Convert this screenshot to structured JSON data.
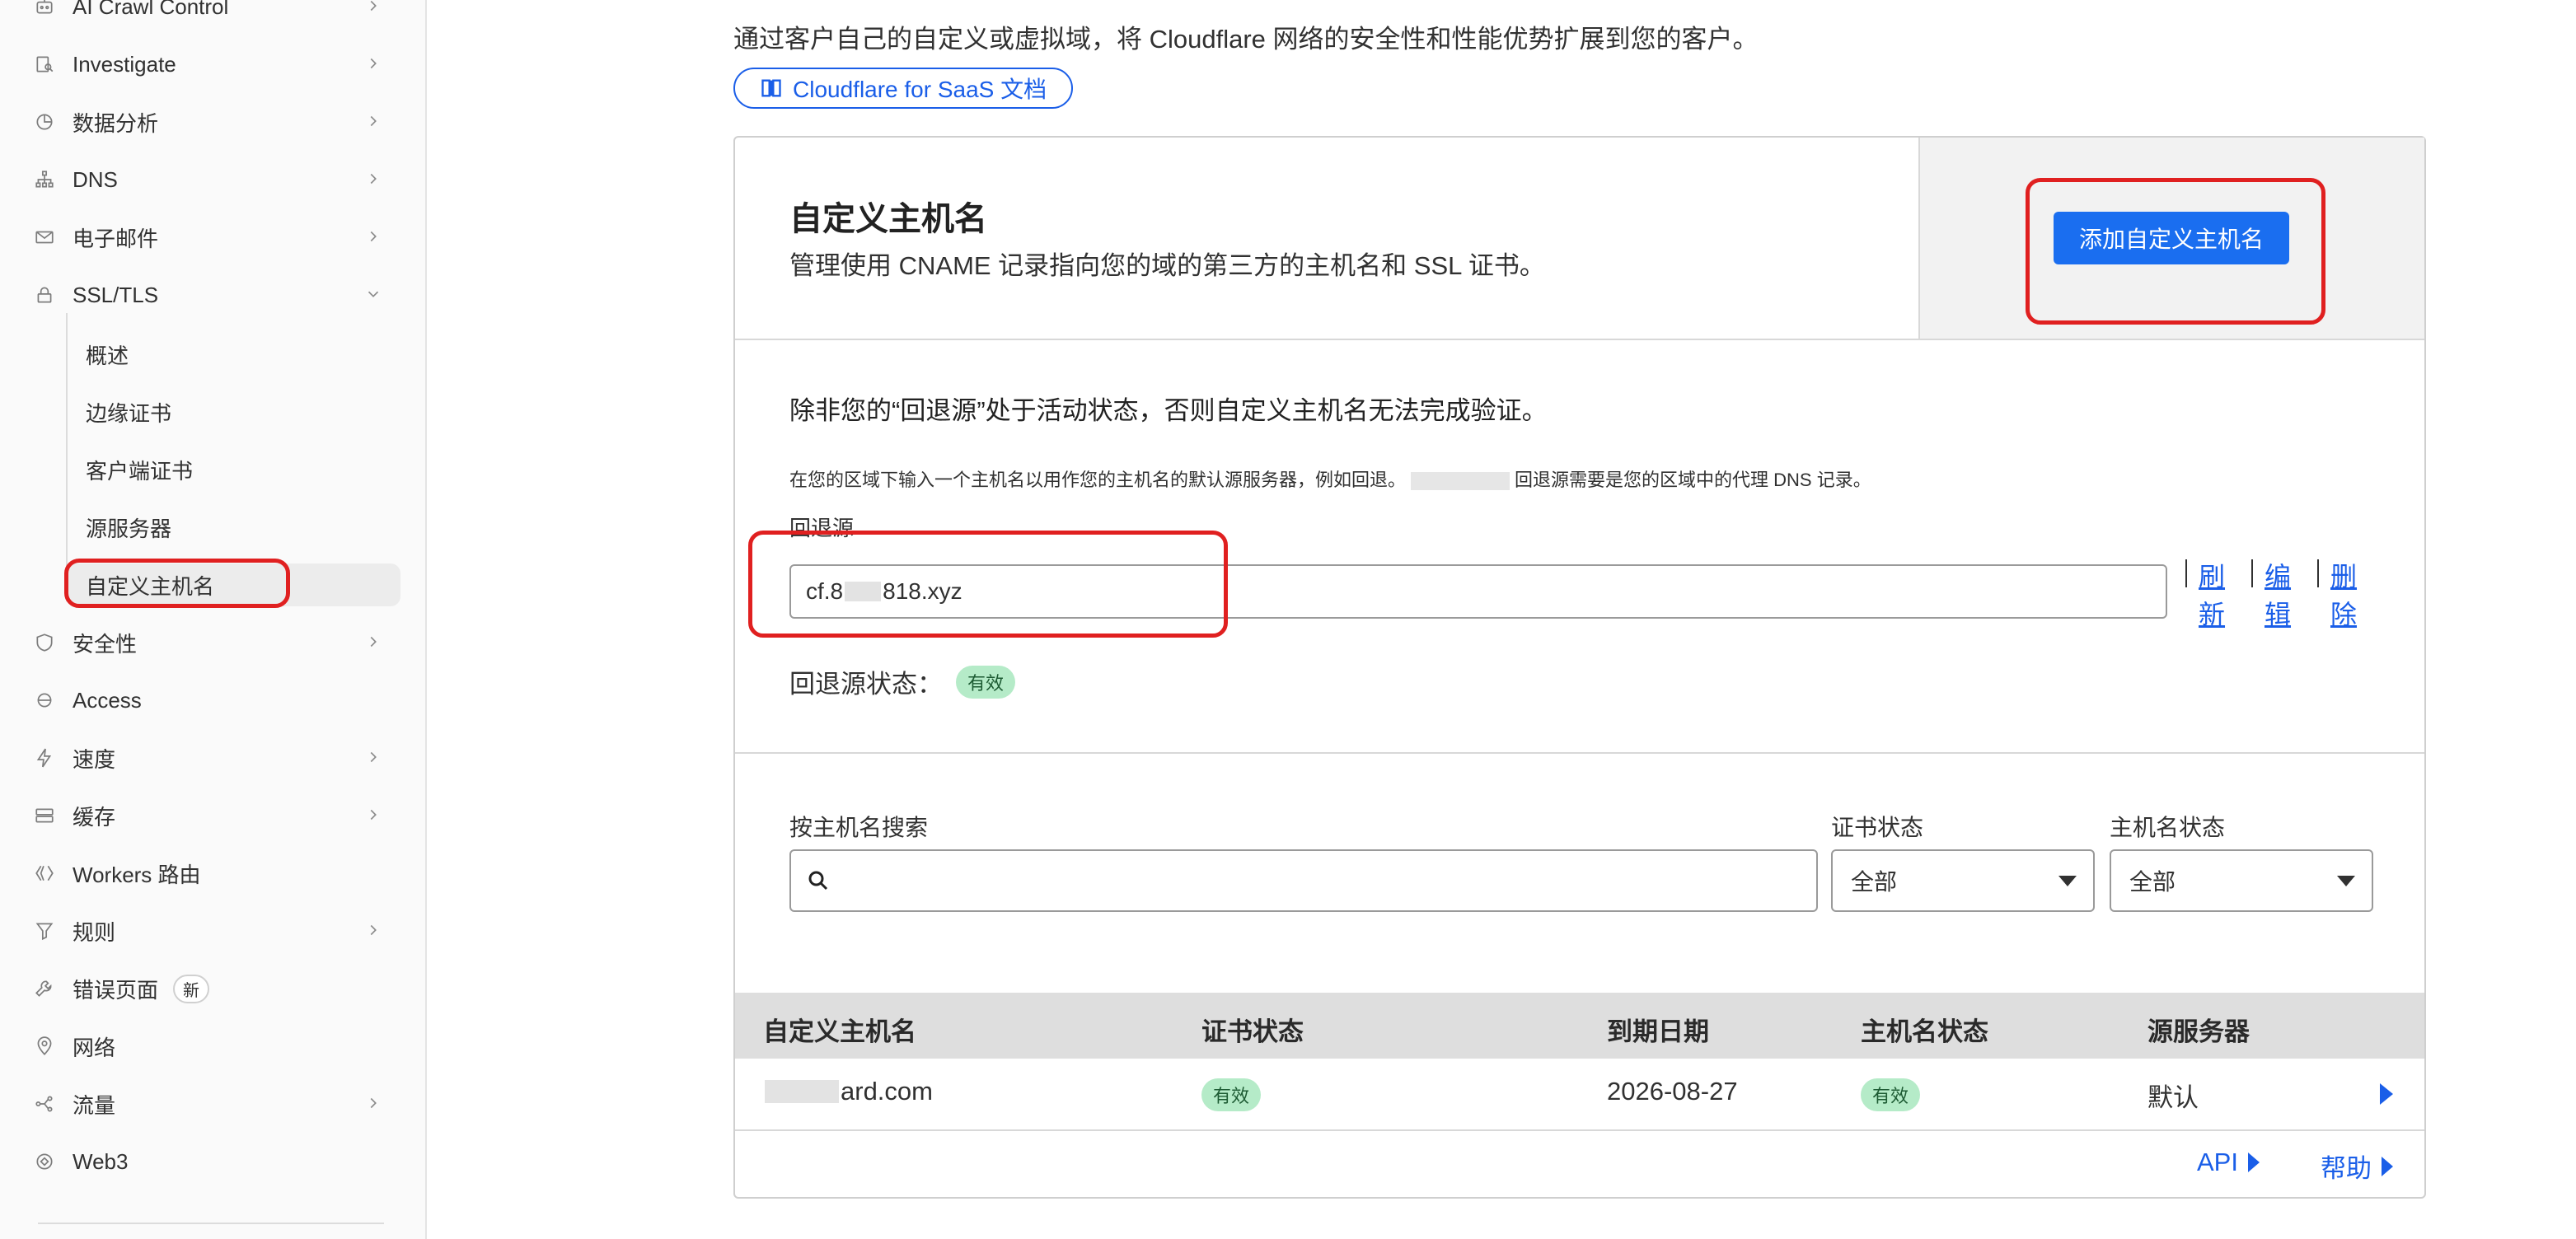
{
  "sidebar": {
    "items": [
      {
        "label": "AI Crawl Control",
        "icon": "bot-icon",
        "chevron": true
      },
      {
        "label": "Investigate",
        "icon": "investigate-icon",
        "chevron": true
      },
      {
        "label": "数据分析",
        "icon": "pie-chart-icon",
        "chevron": true
      },
      {
        "label": "DNS",
        "icon": "network-tree-icon",
        "chevron": true
      },
      {
        "label": "电子邮件",
        "icon": "envelope-icon",
        "chevron": true
      },
      {
        "label": "SSL/TLS",
        "icon": "lock-icon",
        "chevron": true
      },
      {
        "label": "安全性",
        "icon": "shield-icon",
        "chevron": true
      },
      {
        "label": "Access",
        "icon": "access-icon",
        "chevron": false
      },
      {
        "label": "速度",
        "icon": "lightning-icon",
        "chevron": true
      },
      {
        "label": "缓存",
        "icon": "storage-icon",
        "chevron": true
      },
      {
        "label": "Workers 路由",
        "icon": "workers-icon",
        "chevron": false
      },
      {
        "label": "规则",
        "icon": "funnel-icon",
        "chevron": true
      },
      {
        "label": "错误页面",
        "icon": "wrench-icon",
        "chevron": false,
        "badge": "新"
      },
      {
        "label": "网络",
        "icon": "location-pin-icon",
        "chevron": false
      },
      {
        "label": "流量",
        "icon": "traffic-icon",
        "chevron": true
      },
      {
        "label": "Web3",
        "icon": "web3-icon",
        "chevron": false
      }
    ],
    "ssl_sub": [
      "概述",
      "边缘证书",
      "客户端证书",
      "源服务器",
      "自定义主机名"
    ],
    "active_sub": "自定义主机名"
  },
  "main": {
    "intro": "通过客户自己的自定义或虚拟域，将 Cloudflare 网络的安全性和性能优势扩展到您的客户。",
    "doc_link": "Cloudflare for SaaS 文档",
    "card_title": "自定义主机名",
    "card_desc": "管理使用 CNAME 记录指向您的域的第三方的主机名和 SSL 证书。",
    "add_button": "添加自定义主机名",
    "fallback_warning": "除非您的“回退源”处于活动状态，否则自定义主机名无法完成验证。",
    "fallback_help_1": "在您的区域下输入一个主机名以用作您的主机名的默认源服务器，例如回退。",
    "fallback_help_2": "回退源需要是您的区域中的代理 DNS 记录。",
    "fallback_label": "回退源",
    "fallback_value_prefix": "cf.8",
    "fallback_value_suffix": "818.xyz",
    "actions": {
      "refresh": "刷新",
      "edit": "编辑",
      "delete": "删除"
    },
    "fallback_status_label": "回退源状态：",
    "fallback_status_value": "有效",
    "search_label": "按主机名搜索",
    "search_placeholder": "",
    "cert_status_label": "证书状态",
    "cert_status_value": "全部",
    "host_status_label": "主机名状态",
    "host_status_value": "全部"
  },
  "table": {
    "columns": [
      "自定义主机名",
      "证书状态",
      "到期日期",
      "主机名状态",
      "源服务器"
    ],
    "rows": [
      {
        "hostname_suffix": "ard.com",
        "cert_status": "有效",
        "expiry": "2026-08-27",
        "host_status": "有效",
        "origin": "默认"
      }
    ]
  },
  "footer": {
    "api": "API",
    "help": "帮助"
  },
  "colors": {
    "accent": "#1a6ef0",
    "link": "#1a5ee8",
    "success_bg": "#b5ebc8",
    "highlight": "#e02020"
  }
}
